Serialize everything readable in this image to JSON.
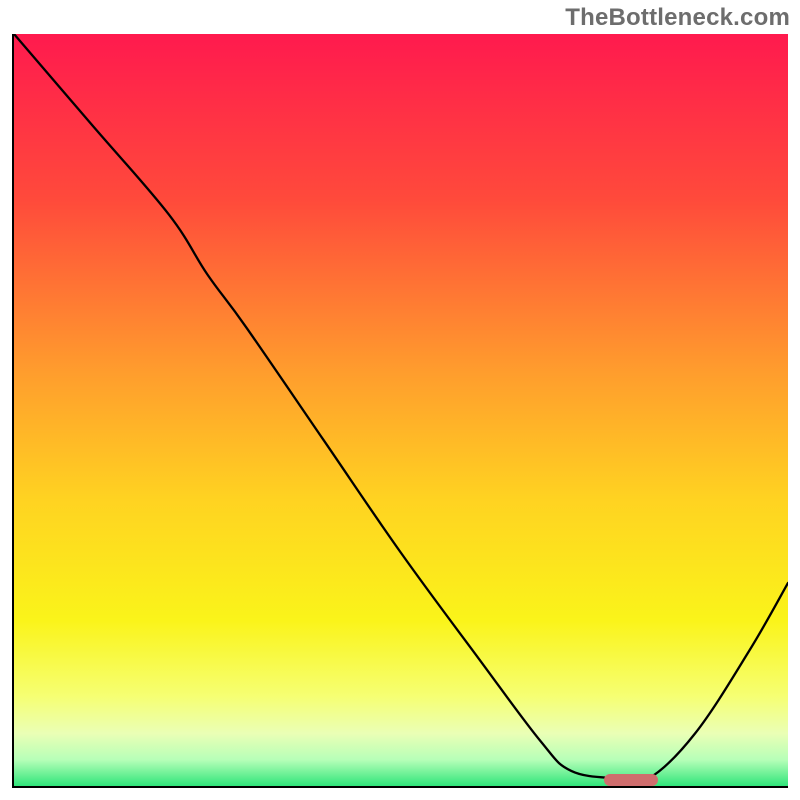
{
  "watermark": "TheBottleneck.com",
  "chart_data": {
    "type": "line",
    "title": "",
    "xlabel": "",
    "ylabel": "",
    "xlim": [
      0,
      100
    ],
    "ylim": [
      0,
      100
    ],
    "grid": false,
    "legend": false,
    "background_gradient": {
      "stops": [
        {
          "offset": 0.0,
          "color": "#ff1a4e"
        },
        {
          "offset": 0.22,
          "color": "#ff4a3b"
        },
        {
          "offset": 0.45,
          "color": "#ff9d2d"
        },
        {
          "offset": 0.62,
          "color": "#ffd321"
        },
        {
          "offset": 0.78,
          "color": "#faf41a"
        },
        {
          "offset": 0.88,
          "color": "#f6ff72"
        },
        {
          "offset": 0.93,
          "color": "#eaffb5"
        },
        {
          "offset": 0.965,
          "color": "#b7ffb8"
        },
        {
          "offset": 1.0,
          "color": "#30e57a"
        }
      ]
    },
    "series": [
      {
        "name": "bottleneck-curve",
        "color": "#000000",
        "width": 2.3,
        "x": [
          0,
          10,
          20,
          25,
          30,
          40,
          50,
          60,
          68,
          72,
          78,
          82,
          88,
          95,
          100
        ],
        "y": [
          100,
          88,
          76,
          68,
          61,
          46,
          31,
          17,
          6,
          2,
          1,
          1,
          7,
          18,
          27
        ]
      }
    ],
    "marker": {
      "name": "optimal-range",
      "x_start": 76,
      "x_end": 83,
      "y": 0.8,
      "color": "#cf6d6d"
    },
    "annotations": []
  }
}
